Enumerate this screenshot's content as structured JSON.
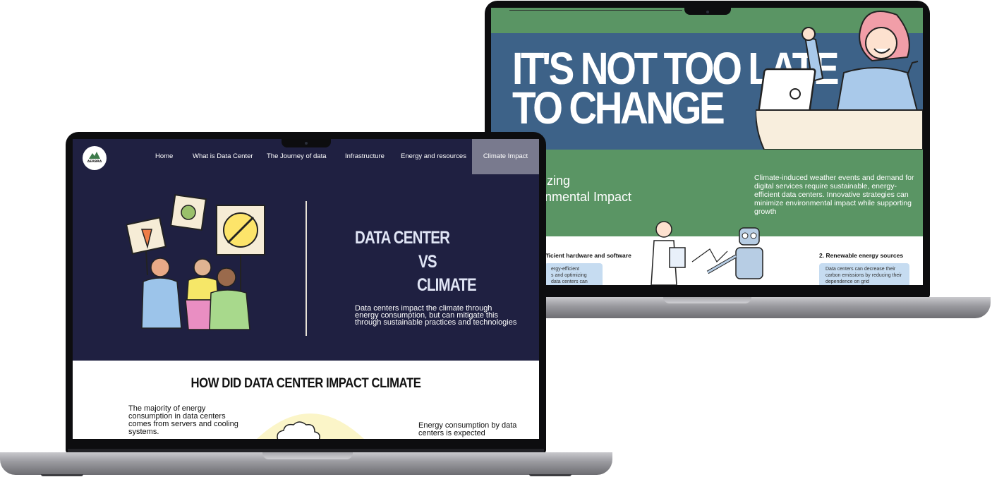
{
  "back_page": {
    "hero_title": "IT'S NOT TOO LATE\nTO CHANGE",
    "section_title": "mizing\nronmental Impact",
    "section_description": "Climate-induced weather events and demand for digital services require sustainable, energy-efficient data centers. Innovative strategies can minimize environmental impact while supporting growth",
    "list_heading_1": "fficient hardware and software",
    "list_heading_2": "2. Renewable energy sources",
    "card_1_text": "ergy-efficient\ns and optimizing\ndata centers can",
    "card_2_text": "Data centers can decrease their carbon emissions by reducing their dependence on grid"
  },
  "front_page": {
    "logo_text": "AERBRA",
    "nav": [
      {
        "label": "Home"
      },
      {
        "label": "What is Data Center"
      },
      {
        "label": "The Journey of data"
      },
      {
        "label": "Infrastructure"
      },
      {
        "label": "Energy and resources"
      },
      {
        "label": "Climate Impact"
      }
    ],
    "active_nav": "Climate Impact",
    "hero": {
      "line1": "DATA CENTER",
      "line2": "VS",
      "line3": "CLIMATE",
      "description": "Data centers impact the climate through energy consumption, but can mitigate this through sustainable practices and technologies"
    },
    "section_title": "HOW DID DATA CENTER IMPACT CLIMATE",
    "section_left_text": "The majority of energy consumption in data centers comes from servers and cooling systems.",
    "section_right_text": "Energy consumption by data centers is expected"
  },
  "colors": {
    "navy": "#1f2041",
    "green": "#5a9564",
    "blue": "#3d6288",
    "active_nav": "#797a8e"
  }
}
